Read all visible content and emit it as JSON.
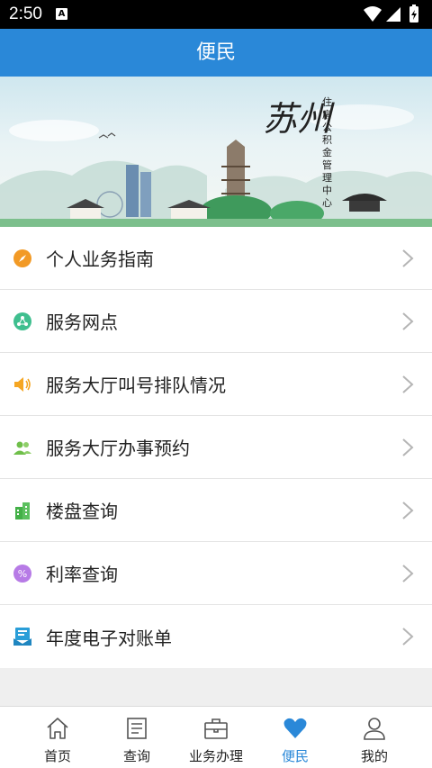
{
  "status_bar": {
    "time": "2:50",
    "notification_icon": "A"
  },
  "header": {
    "title": "便民"
  },
  "banner": {
    "city": "苏州",
    "org": "住房公积金管理中心"
  },
  "menu": {
    "items": [
      {
        "label": "个人业务指南",
        "icon": "compass-icon",
        "color": "#f29a26"
      },
      {
        "label": "服务网点",
        "icon": "network-icon",
        "color": "#3fbf8f"
      },
      {
        "label": "服务大厅叫号排队情况",
        "icon": "speaker-icon",
        "color": "#f5a623"
      },
      {
        "label": "服务大厅办事预约",
        "icon": "people-icon",
        "color": "#6fbf4a"
      },
      {
        "label": "楼盘查询",
        "icon": "building-icon",
        "color": "#43b047"
      },
      {
        "label": "利率查询",
        "icon": "percent-icon",
        "color": "#b77be6"
      },
      {
        "label": "年度电子对账单",
        "icon": "statement-icon",
        "color": "#2a9ed8"
      }
    ]
  },
  "tabbar": {
    "tabs": [
      {
        "label": "首页",
        "icon": "home-icon"
      },
      {
        "label": "查询",
        "icon": "document-icon"
      },
      {
        "label": "业务办理",
        "icon": "briefcase-icon"
      },
      {
        "label": "便民",
        "icon": "heart-icon",
        "active": true
      },
      {
        "label": "我的",
        "icon": "person-icon"
      }
    ]
  },
  "colors": {
    "primary": "#2a88d8",
    "background": "#efefef"
  }
}
